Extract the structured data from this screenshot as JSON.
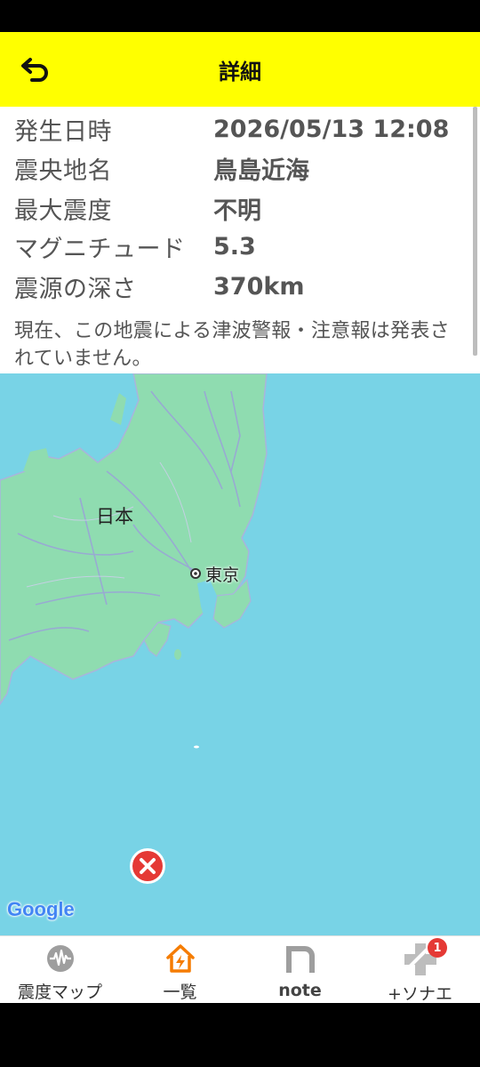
{
  "header": {
    "title": "詳細"
  },
  "details": [
    {
      "label": "発生日時",
      "value": "2026/05/13 12:08"
    },
    {
      "label": "震央地名",
      "value": "鳥島近海"
    },
    {
      "label": "最大震度",
      "value": "不明"
    },
    {
      "label": "マグニチュード",
      "value": "5.3"
    },
    {
      "label": "震源の深さ",
      "value": "370km"
    }
  ],
  "notice": "現在、この地震による津波警報・注意報は発表されていません。",
  "map": {
    "country_label": "日本",
    "city_label": "東京",
    "attribution": "Google",
    "colors": {
      "sea": "#78d3e6",
      "land": "#8fdcb0",
      "epicenter": "#e53935"
    }
  },
  "nav": {
    "items": [
      {
        "label": "震度マップ",
        "icon": "seismograph-icon"
      },
      {
        "label": "一覧",
        "icon": "house-lightning-icon"
      },
      {
        "label": "note",
        "icon": "note-logo-icon"
      },
      {
        "label": "+ソナエ",
        "icon": "plus-sonae-icon",
        "badge": "1"
      }
    ]
  }
}
